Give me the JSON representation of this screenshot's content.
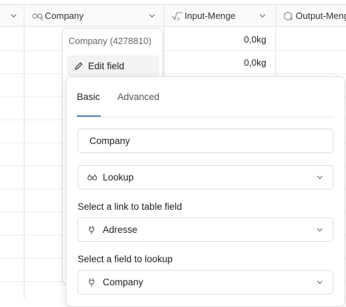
{
  "table": {
    "columns": [
      {
        "label": "Company",
        "icon": "lookup-icon"
      },
      {
        "label": "Input-Menge",
        "icon": "formula-icon"
      },
      {
        "label": "Output-Menge",
        "icon": "lookup-box-icon"
      }
    ],
    "input_values": [
      "0,0kg",
      "0,0kg"
    ]
  },
  "field_menu": {
    "title": "Company (4278810)",
    "edit_label": "Edit field"
  },
  "edit_panel": {
    "tabs": [
      "Basic",
      "Advanced"
    ],
    "active_tab": "Basic",
    "name_value": "Company",
    "type_value": "Lookup",
    "link_label": "Select a link to table field",
    "link_value": "Adresse",
    "lookup_label": "Select a field to lookup",
    "lookup_value": "Company"
  },
  "colors": {
    "accent": "#5a7fb8",
    "border": "#dcdcdc",
    "header_bg": "#fafafa"
  }
}
